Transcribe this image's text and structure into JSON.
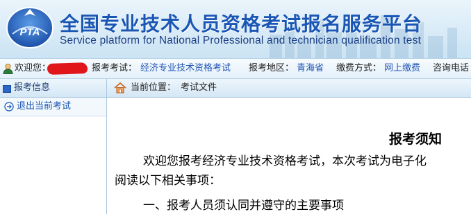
{
  "banner": {
    "title": "全国专业技术人员资格考试报名服务平台",
    "subtitle": "Service platform for National Professional and technician qualification test",
    "logo_text": "PTA"
  },
  "infobar": {
    "welcome_label": "欢迎您：",
    "exam_label": "报考考试：",
    "exam_value": "经济专业技术资格考试",
    "region_label": "报考地区：",
    "region_value": "青海省",
    "payment_label": "缴费方式：",
    "payment_value": "网上缴费",
    "phone_label": "咨询电话"
  },
  "sidebar": {
    "header": "报考信息",
    "items": [
      {
        "label": "退出当前考试",
        "icon": "arrow-circle-icon"
      }
    ]
  },
  "breadcrumb": {
    "label": "当前位置：",
    "value": "考试文件"
  },
  "document": {
    "title": "报考须知",
    "paragraph1": "欢迎您报考经济专业技术资格考试，本次考试为电子化",
    "paragraph2": "阅读以下相关事项：",
    "section1": "一、报考人员须认同并遵守的主要事项"
  },
  "colors": {
    "brand_blue": "#1a56b4",
    "link_blue": "#2155b6",
    "redaction_red": "#e0161b"
  }
}
